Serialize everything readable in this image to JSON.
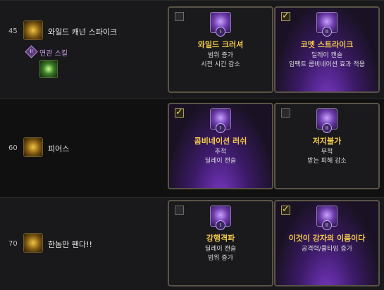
{
  "rows": [
    {
      "level": "45",
      "skill_name": "와일드 캐넌 스파이크",
      "related": {
        "badge": "II",
        "label": "연관 스킬"
      },
      "options": [
        {
          "checked": false,
          "tier": "I",
          "title": "와일드 크러셔",
          "lines": [
            "범위 증가",
            "시전 시간 감소"
          ]
        },
        {
          "checked": true,
          "tier": "II",
          "title": "코멧 스트라이크",
          "lines": [
            "딜레이 캔슬",
            "임팩트 콤비네이션 효과 적용"
          ]
        }
      ]
    },
    {
      "level": "60",
      "skill_name": "피어스",
      "options": [
        {
          "checked": true,
          "tier": "I",
          "title": "콤비네이션 러쉬",
          "lines": [
            "추적",
            "딜레이 캔슬"
          ]
        },
        {
          "checked": false,
          "tier": "II",
          "title": "저지불가",
          "lines": [
            "무적",
            "받는 피해 감소"
          ]
        }
      ]
    },
    {
      "level": "70",
      "skill_name": "한놈만 팬다!!",
      "options": [
        {
          "checked": false,
          "tier": "I",
          "title": "강행격파",
          "lines": [
            "딜레이 캔슬",
            "범위 증가"
          ]
        },
        {
          "checked": true,
          "tier": "II",
          "title": "이것이 강자의 이름이다",
          "lines": [
            "공격력/쿨타임 증가",
            ""
          ]
        }
      ]
    }
  ],
  "colors": {
    "accent_title": "#f2c84b",
    "check_mark": "#f3d24d",
    "related_label": "#c89be8",
    "card_border": "#5b5346"
  },
  "icons": {
    "row_skill_45": "wild-cannon-spike-icon",
    "row_skill_60": "pierce-icon",
    "row_skill_70": "one-target-beatdown-icon",
    "related_skill": "related-skill-icon",
    "rune": "tripod-rune-icon"
  }
}
